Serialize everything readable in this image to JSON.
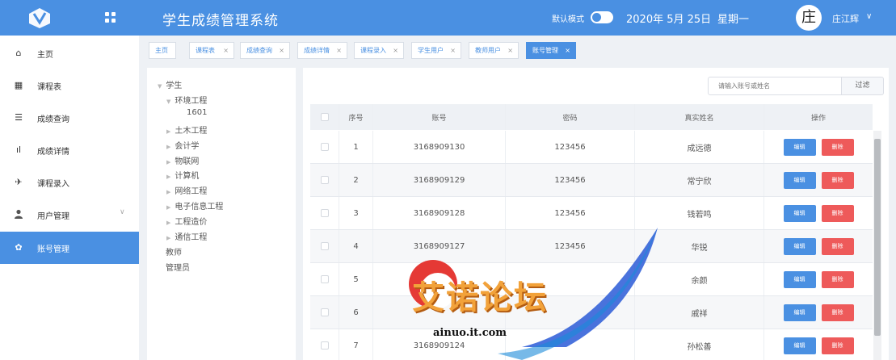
{
  "header": {
    "title": "学生成绩管理系统",
    "dark_mode_label": "默认模式",
    "date": "2020年 5月 25日",
    "weekday": "星期一",
    "avatar_char": "庄",
    "username": "庄江辉",
    "caret": "∨"
  },
  "sidebar": {
    "items": [
      {
        "label": "主页",
        "icon": "home-icon",
        "glyph": "⌂"
      },
      {
        "label": "课程表",
        "icon": "grid-icon",
        "glyph": "▦"
      },
      {
        "label": "成绩查询",
        "icon": "list-icon",
        "glyph": "☰"
      },
      {
        "label": "成绩详情",
        "icon": "bar-chart-icon",
        "glyph": "ıl"
      },
      {
        "label": "课程录入",
        "icon": "send-icon",
        "glyph": "✈"
      },
      {
        "label": "用户管理",
        "icon": "user-icon",
        "glyph": "👤",
        "caret": "∨"
      },
      {
        "label": "账号管理",
        "icon": "gear-icon",
        "glyph": "✿"
      }
    ]
  },
  "tabs": [
    {
      "label": "主页"
    },
    {
      "label": "课程表",
      "close": "×"
    },
    {
      "label": "成绩查询",
      "close": "×"
    },
    {
      "label": "成绩详情",
      "close": "×"
    },
    {
      "label": "课程录入",
      "close": "×"
    },
    {
      "label": "学生用户",
      "close": "×"
    },
    {
      "label": "教师用户",
      "close": "×"
    },
    {
      "label": "账号管理",
      "close": "×"
    }
  ],
  "tree": {
    "root": "学生",
    "majors": [
      "环境工程",
      "土木工程",
      "会计学",
      "物联网",
      "计算机",
      "网络工程",
      "电子信息工程",
      "工程造价",
      "通信工程"
    ],
    "class_1601": "1601",
    "teachers": "教师",
    "admins": "管理员"
  },
  "search": {
    "placeholder": "请输入账号或姓名",
    "filter_label": "过滤"
  },
  "table": {
    "headers": {
      "index": "序号",
      "account": "账号",
      "password": "密码",
      "real_name": "真实姓名",
      "actions": "操作"
    },
    "edit_label": "编辑",
    "delete_label": "删除",
    "rows": [
      {
        "index": "1",
        "account": "3168909130",
        "password": "123456",
        "name": "成远德"
      },
      {
        "index": "2",
        "account": "3168909129",
        "password": "123456",
        "name": "常宁欣"
      },
      {
        "index": "3",
        "account": "3168909128",
        "password": "123456",
        "name": "钱若鸣"
      },
      {
        "index": "4",
        "account": "3168909127",
        "password": "123456",
        "name": "华锐"
      },
      {
        "index": "5",
        "account": "",
        "password": "",
        "name": "余颜"
      },
      {
        "index": "6",
        "account": "",
        "password": "",
        "name": "戚祥"
      },
      {
        "index": "7",
        "account": "3168909124",
        "password": "",
        "name": "孙松善"
      }
    ]
  },
  "watermark": {
    "text": "艾诺论坛",
    "url": "ainuo.it.com"
  },
  "colors": {
    "primary": "#4a90e2",
    "danger": "#ee5a5a",
    "watermark_orange": "#f2a23a"
  }
}
